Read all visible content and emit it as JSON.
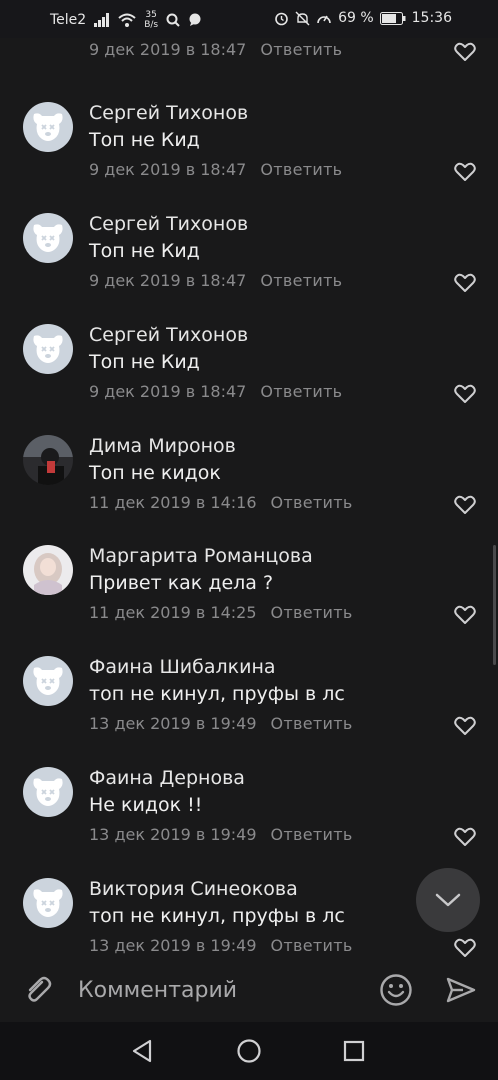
{
  "status_bar": {
    "carrier": "Tele2",
    "speed_value": "35",
    "speed_unit": "B/s",
    "battery": "69 %",
    "time": "15:36"
  },
  "reply_label": "Ответить",
  "comments": [
    {
      "name": "",
      "text": "Топ не Кид",
      "date": "9 дек 2019 в 18:47",
      "avatar": "dog"
    },
    {
      "name": "Сергей Тихонов",
      "text": "Топ не Кид",
      "date": "9 дек 2019 в 18:47",
      "avatar": "dog"
    },
    {
      "name": "Сергей Тихонов",
      "text": "Топ не Кид",
      "date": "9 дек 2019 в 18:47",
      "avatar": "dog"
    },
    {
      "name": "Сергей Тихонов",
      "text": "Топ не Кид",
      "date": "9 дек 2019 в 18:47",
      "avatar": "dog"
    },
    {
      "name": "Дима Миронов",
      "text": "Топ не кидок",
      "date": "11 дек 2019 в 14:16",
      "avatar": "photo-dark"
    },
    {
      "name": "Маргарита Романцова",
      "text": "Привет как дела ?",
      "date": "11 дек 2019 в 14:25",
      "avatar": "photo-light"
    },
    {
      "name": "Фаина Шибалкина",
      "text": "топ не кинул, пруфы в лс",
      "date": "13 дек 2019 в 19:49",
      "avatar": "dog"
    },
    {
      "name": "Фаина Дернова",
      "text": "Не кидок !!",
      "date": "13 дек 2019 в 19:49",
      "avatar": "dog"
    },
    {
      "name": "Виктория Синеокова",
      "text": "топ не кинул, пруфы в лс",
      "date": "13 дек 2019 в 19:49",
      "avatar": "dog"
    }
  ],
  "composer": {
    "placeholder": "Комментарий"
  },
  "icons": {
    "attach": "paperclip-icon",
    "emoji": "smiley-icon",
    "send": "send-icon",
    "like": "heart-icon",
    "scroll_down": "chevron-down-icon",
    "nav_back": "back-triangle-icon",
    "nav_home": "home-circle-icon",
    "nav_recents": "recents-square-icon"
  },
  "colors": {
    "background": "#19191a",
    "secondary_text": "#8a8a8c",
    "avatar_placeholder": "#ccd4dd"
  }
}
